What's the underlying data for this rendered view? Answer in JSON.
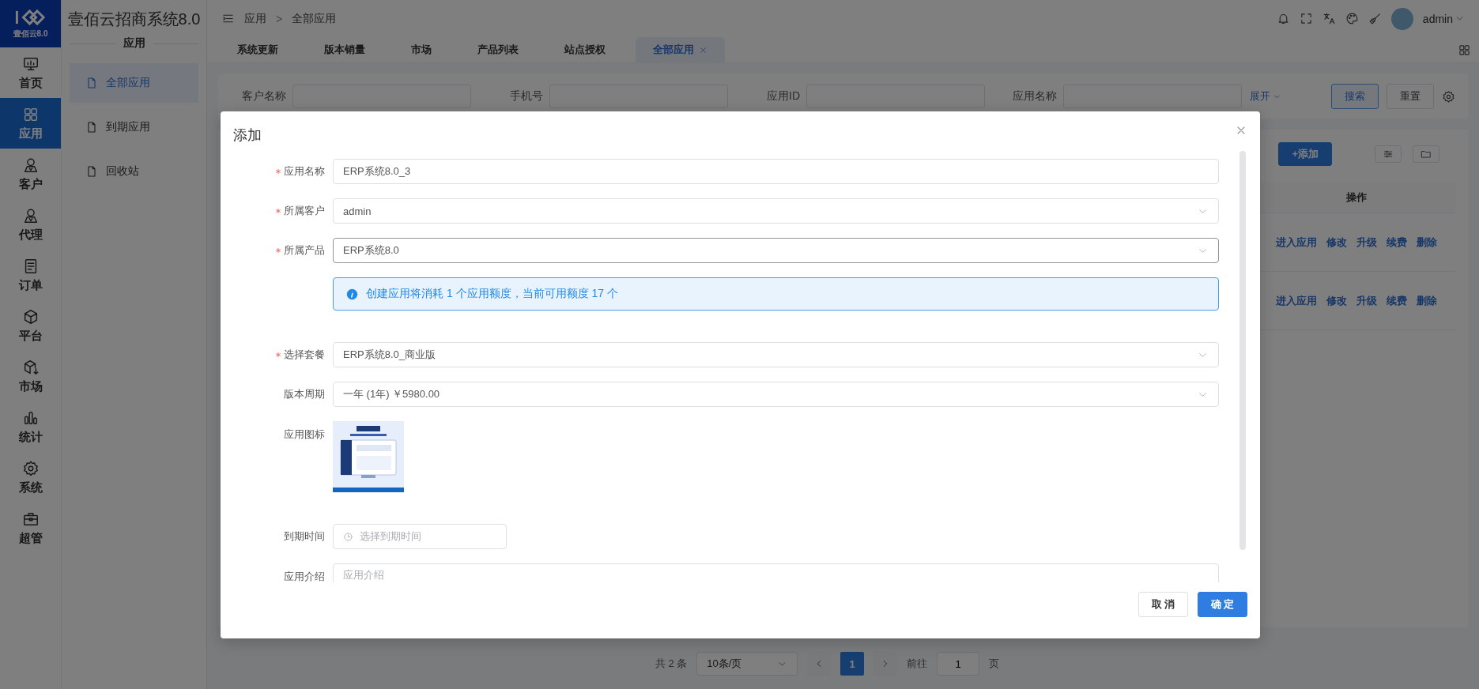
{
  "logo": {
    "caption": "壹佰云8.0"
  },
  "nav": [
    {
      "label": "首页",
      "selected": false
    },
    {
      "label": "应用",
      "selected": true
    },
    {
      "label": "客户",
      "selected": false
    },
    {
      "label": "代理",
      "selected": false
    },
    {
      "label": "订单",
      "selected": false
    },
    {
      "label": "平台",
      "selected": false
    },
    {
      "label": "市场",
      "selected": false
    },
    {
      "label": "统计",
      "selected": false
    },
    {
      "label": "系统",
      "selected": false
    },
    {
      "label": "超管",
      "selected": false
    }
  ],
  "sidebar": {
    "title": "壹佰云招商系统8.0",
    "section": "应用",
    "items": [
      {
        "label": "全部应用",
        "selected": true
      },
      {
        "label": "到期应用",
        "selected": false
      },
      {
        "label": "回收站",
        "selected": false
      }
    ]
  },
  "header": {
    "breadcrumb": [
      "应用",
      "全部应用"
    ],
    "separator": ">",
    "user": "admin"
  },
  "tabs": [
    {
      "label": "系统更新",
      "selected": false,
      "closable": false
    },
    {
      "label": "版本销量",
      "selected": false,
      "closable": false
    },
    {
      "label": "市场",
      "selected": false,
      "closable": false
    },
    {
      "label": "产品列表",
      "selected": false,
      "closable": false
    },
    {
      "label": "站点授权",
      "selected": false,
      "closable": false
    },
    {
      "label": "全部应用",
      "selected": true,
      "closable": true
    }
  ],
  "filters": [
    {
      "label": "客户名称"
    },
    {
      "label": "手机号"
    },
    {
      "label": "应用ID"
    },
    {
      "label": "应用名称"
    }
  ],
  "filter_actions": {
    "expand": "展开",
    "search": "搜索",
    "reset": "重置"
  },
  "toolbar": {
    "add": "+添加"
  },
  "table": {
    "columns": [
      "操作"
    ],
    "rows": [
      {
        "actions": [
          "进入应用",
          "修改",
          "升级",
          "续费",
          "删除"
        ]
      },
      {
        "actions": [
          "进入应用",
          "修改",
          "升级",
          "续费",
          "删除"
        ]
      }
    ]
  },
  "pagination": {
    "total": "共 2 条",
    "page_size": "10条/页",
    "pages": [
      {
        "label": "1",
        "selected": true
      }
    ],
    "goto": "前往",
    "goto_value": "1",
    "suffix": "页"
  },
  "dialog": {
    "title": "添加",
    "fields": [
      {
        "kind": "input",
        "label": "应用名称",
        "required": true,
        "value": "ERP系统8.0_3",
        "focused": false
      },
      {
        "kind": "select",
        "label": "所属客户",
        "required": true,
        "value": "admin",
        "focused": false
      },
      {
        "kind": "select",
        "label": "所属产品",
        "required": true,
        "value": "ERP系统8.0",
        "focused": true
      },
      {
        "kind": "alert",
        "text": "创建应用将消耗 1 个应用额度，当前可用额度 17 个"
      },
      {
        "kind": "select",
        "label": "选择套餐",
        "required": true,
        "value": "ERP系统8.0_商业版",
        "focused": false
      },
      {
        "kind": "select",
        "label": "版本周期",
        "required": false,
        "value": "一年 (1年) ￥5980.00",
        "focused": false
      },
      {
        "kind": "image",
        "label": "应用图标",
        "required": false
      },
      {
        "kind": "date",
        "label": "到期时间",
        "required": false,
        "placeholder": "选择到期时间"
      },
      {
        "kind": "textarea",
        "label": "应用介绍",
        "required": false,
        "placeholder": "应用介绍"
      }
    ],
    "buttons": {
      "cancel": "取 消",
      "ok": "确 定"
    }
  }
}
